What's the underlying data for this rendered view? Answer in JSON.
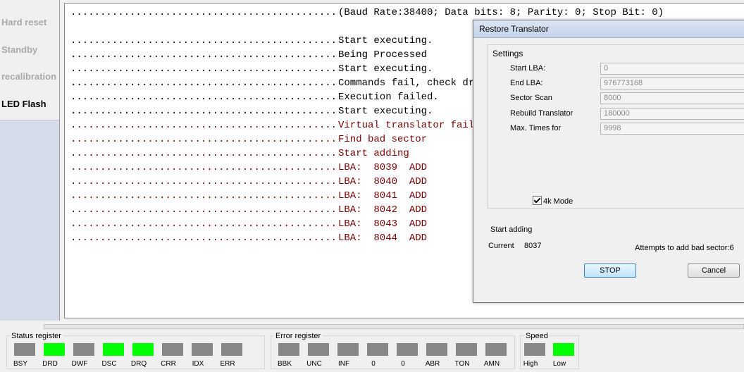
{
  "sidebar": {
    "items": [
      {
        "label": "Hard reset",
        "active": false
      },
      {
        "label": "Standby",
        "active": false
      },
      {
        "label": "recalibration",
        "active": false
      },
      {
        "label": "LED Flash",
        "active": true
      }
    ]
  },
  "log": {
    "dots": "..................................................",
    "header": "(Baud Rate:38400; Data bits: 8; Parity: 0; Stop Bit: 0)",
    "lines": [
      {
        "text": "Start executing.",
        "color": "dark"
      },
      {
        "text": "Being Processed",
        "color": "dark"
      },
      {
        "text": "Start executing.",
        "color": "dark"
      },
      {
        "text": "Commands fail, check dri",
        "color": "dark"
      },
      {
        "text": "Execution failed.",
        "color": "dark"
      },
      {
        "text": "Start executing.",
        "color": "dark"
      },
      {
        "text": "Virtual translator faile",
        "color": "red"
      },
      {
        "text": "Find bad sector",
        "color": "red"
      },
      {
        "text": "Start adding",
        "color": "red"
      },
      {
        "text": "LBA:  8039  ADD",
        "color": "red"
      },
      {
        "text": "LBA:  8040  ADD",
        "color": "red"
      },
      {
        "text": "LBA:  8041  ADD",
        "color": "red"
      },
      {
        "text": "LBA:  8042  ADD",
        "color": "red"
      },
      {
        "text": "LBA:  8043  ADD",
        "color": "red"
      },
      {
        "text": "LBA:  8044  ADD",
        "color": "red"
      }
    ]
  },
  "dialog": {
    "title": "Restore Translator",
    "settings_legend": "Settings",
    "fields": [
      {
        "label": "Start LBA:",
        "value": "0"
      },
      {
        "label": "End LBA:",
        "value": "976773168"
      },
      {
        "label": "Sector Scan",
        "value": "8000"
      },
      {
        "label": "Rebuild Translator",
        "value": "180000"
      },
      {
        "label": "Max. Times for",
        "value": "9998"
      }
    ],
    "checkbox_4k": {
      "label": "4k Mode",
      "checked": true
    },
    "status": "Start adding",
    "current_label": "Current",
    "current_value": "8037",
    "attempts": "Attempts to add bad sector:6",
    "stop_label": "STOP",
    "cancel_label": "Cancel"
  },
  "registers": {
    "status": {
      "title": "Status register",
      "leds": [
        {
          "label": "BSY",
          "on": false
        },
        {
          "label": "DRD",
          "on": true
        },
        {
          "label": "DWF",
          "on": false
        },
        {
          "label": "DSC",
          "on": true
        },
        {
          "label": "DRQ",
          "on": true
        },
        {
          "label": "CRR",
          "on": false
        },
        {
          "label": "IDX",
          "on": false
        },
        {
          "label": "ERR",
          "on": false
        }
      ]
    },
    "error": {
      "title": "Error register",
      "leds": [
        {
          "label": "BBK",
          "on": false
        },
        {
          "label": "UNC",
          "on": false
        },
        {
          "label": "INF",
          "on": false
        },
        {
          "label": "0",
          "on": false
        },
        {
          "label": "0",
          "on": false
        },
        {
          "label": "ABR",
          "on": false
        },
        {
          "label": "TON",
          "on": false
        },
        {
          "label": "AMN",
          "on": false
        }
      ]
    },
    "speed": {
      "title": "Speed",
      "leds": [
        {
          "label": "High",
          "on": false
        },
        {
          "label": "Low",
          "on": true
        }
      ]
    }
  },
  "colors": {
    "led_on": "#00ff00",
    "led_off": "#878787",
    "log_red": "#7a0000"
  }
}
